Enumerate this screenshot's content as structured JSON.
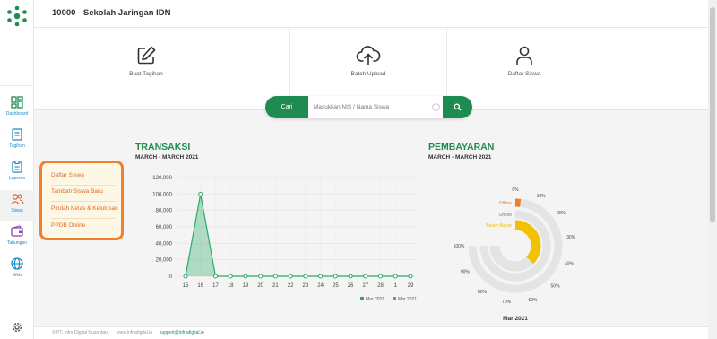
{
  "header": {
    "title": "10000 - Sekolah Jaringan IDN"
  },
  "sidebar": {
    "items": [
      {
        "label": "Dashboard"
      },
      {
        "label": "Tagihan"
      },
      {
        "label": "Laporan"
      },
      {
        "label": "Siswa"
      },
      {
        "label": "Tabungan"
      },
      {
        "label": "Web"
      }
    ]
  },
  "actions": [
    {
      "label": "Buat Tagihan",
      "icon": "edit-icon"
    },
    {
      "label": "Batch Upload",
      "icon": "cloud-upload-icon"
    },
    {
      "label": "Daftar Siswa",
      "icon": "user-icon"
    }
  ],
  "search": {
    "button_label": "Cari",
    "placeholder": "Masukkan NIS / Nama Siswa"
  },
  "transaksi": {
    "title": "TRANSAKSI",
    "subtitle": "MARCH - MARCH 2021"
  },
  "pembayaran": {
    "title": "PEMBAYARAN",
    "subtitle": "MARCH - MARCH 2021"
  },
  "siswa_menu": {
    "items": [
      "Daftar Siswa",
      "Tambah Siswa Baru",
      "Pindah Kelas & Kelulusan",
      "PPDB Online"
    ]
  },
  "footer": {
    "copyright": "© PT. Infra Digital Nusantara",
    "website": "www.infradigital.io",
    "email": "support@infradigital.io"
  },
  "colors": {
    "accent": "#1e8c52",
    "orange": "#f0802c",
    "yellow": "#f2c200",
    "nav_blue": "#1e88c8"
  },
  "chart_data": [
    {
      "type": "area",
      "categories": [
        "15",
        "16",
        "17",
        "18",
        "19",
        "20",
        "21",
        "22",
        "23",
        "24",
        "25",
        "26",
        "27",
        "28",
        "1",
        "29"
      ],
      "series": [
        {
          "name": "Mar 2021",
          "color": "#2ea869",
          "values": [
            0,
            100000,
            0,
            0,
            0,
            0,
            0,
            0,
            0,
            0,
            0,
            0,
            0,
            0,
            0,
            0
          ]
        },
        {
          "name": "Mar 2021",
          "color": "#5b8fd6",
          "values": [
            0,
            0,
            0,
            0,
            0,
            0,
            0,
            0,
            0,
            0,
            0,
            0,
            0,
            0,
            0,
            0
          ]
        }
      ],
      "yticks": [
        "0",
        "20,000",
        "40,000",
        "60,000",
        "80,000",
        "100,000",
        "120,000"
      ],
      "ylim": [
        0,
        120000
      ],
      "legend": "bottom-right",
      "grid": true
    },
    {
      "type": "radial-bar",
      "series": [
        {
          "name": "Offline",
          "value": 2.5,
          "color": "#f0802c"
        },
        {
          "name": "Online",
          "value": 0,
          "color": "#999999"
        },
        {
          "name": "Belum Bayar",
          "value": 50,
          "color": "#f2c200"
        }
      ],
      "ticks": [
        "0%",
        "10%",
        "20%",
        "30%",
        "40%",
        "50%",
        "60%",
        "70%",
        "80%",
        "90%",
        "100%"
      ],
      "period_label": "Mar 2021"
    }
  ]
}
